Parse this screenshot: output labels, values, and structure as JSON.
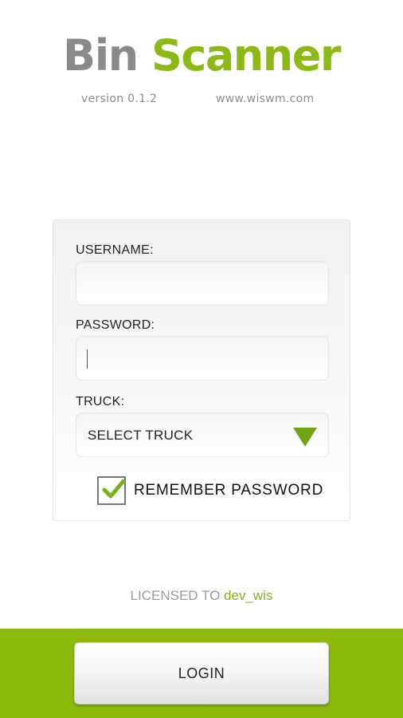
{
  "app": {
    "title_part1": "Bin",
    "title_part2": "Scanner",
    "version": "version 0.1.2",
    "website": "www.wiswm.com"
  },
  "form": {
    "username_label": "USERNAME:",
    "username_value": "",
    "password_label": "PASSWORD:",
    "password_value": "",
    "truck_label": "TRUCK:",
    "truck_selected": "SELECT TRUCK",
    "remember_label": "REMEMBER PASSWORD",
    "remember_checked": true
  },
  "license": {
    "prefix": "LICENSED TO",
    "licensee": "dev_wis"
  },
  "actions": {
    "login_label": "LOGIN"
  },
  "colors": {
    "brand_green": "#8cba14",
    "bottom_bar": "#8cba0a",
    "title_gray": "#8a8a8a",
    "dropdown_arrow": "#6fa512"
  },
  "icons": {
    "dropdown": "triangle-down",
    "checkbox": "checkmark"
  }
}
